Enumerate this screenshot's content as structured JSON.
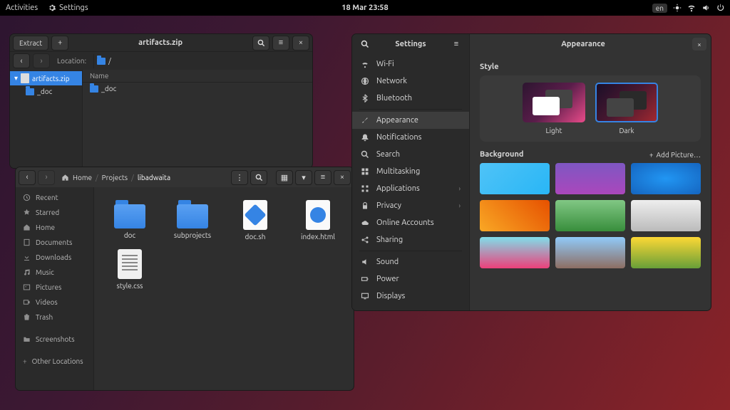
{
  "topbar": {
    "activities": "Activities",
    "settings": "Settings",
    "datetime": "18 Mar  23:58",
    "lang": "en"
  },
  "archive": {
    "extract": "Extract",
    "title": "artifacts.zip",
    "location_label": "Location:",
    "location_path": "/",
    "tree_root": "artifacts.zip",
    "tree_child": "_doc",
    "col_name": "Name",
    "item1": "_doc"
  },
  "files": {
    "breadcrumb": [
      "Home",
      "Projects",
      "libadwaita"
    ],
    "sidebar": {
      "recent": "Recent",
      "starred": "Starred",
      "home": "Home",
      "documents": "Documents",
      "downloads": "Downloads",
      "music": "Music",
      "pictures": "Pictures",
      "videos": "Videos",
      "trash": "Trash",
      "screenshots": "Screenshots",
      "other": "Other Locations"
    },
    "items": {
      "doc": "doc",
      "subprojects": "subprojects",
      "docsh": "doc.sh",
      "index": "index.html",
      "style": "style.css"
    }
  },
  "settings": {
    "title_left": "Settings",
    "title_right": "Appearance",
    "nav": {
      "wifi": "Wi-Fi",
      "network": "Network",
      "bluetooth": "Bluetooth",
      "appearance": "Appearance",
      "notifications": "Notifications",
      "search": "Search",
      "multitasking": "Multitasking",
      "applications": "Applications",
      "privacy": "Privacy",
      "online": "Online Accounts",
      "sharing": "Sharing",
      "sound": "Sound",
      "power": "Power",
      "displays": "Displays"
    },
    "style": {
      "heading": "Style",
      "light": "Light",
      "dark": "Dark"
    },
    "background": {
      "heading": "Background",
      "add": "Add Picture…"
    }
  }
}
